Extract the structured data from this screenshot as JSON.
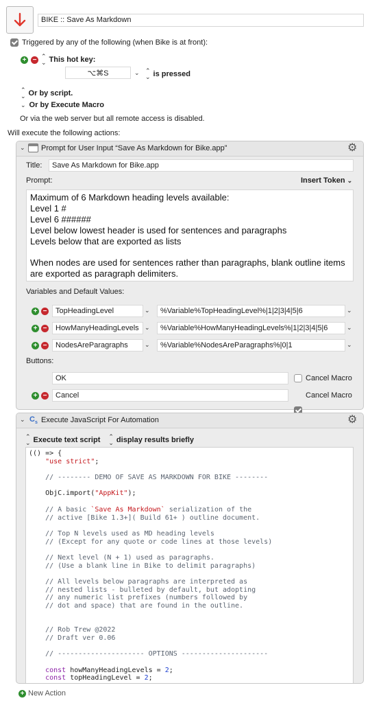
{
  "macro": {
    "name": "BIKE :: Save As Markdown",
    "trigger_text": "Triggered by any of the following (when Bike is at front):",
    "hotkey_label": "This hot key:",
    "hotkey_value": "⌥⌘S",
    "hotkey_condition": "is pressed",
    "by_script_label": "Or by script.",
    "by_execute_macro_label": "Or by Execute Macro",
    "web_server_text": "Or via the web server but all remote access is disabled.",
    "will_execute_text": "Will execute the following actions:",
    "new_action_label": "New Action"
  },
  "prompt_action": {
    "header": "Prompt for User Input “Save As Markdown for Bike.app”",
    "title_label": "Title:",
    "title_value": "Save As Markdown for Bike.app",
    "prompt_label": "Prompt:",
    "insert_token_label": "Insert Token",
    "prompt_lines": [
      "Maximum of 6 Markdown heading levels available:",
      "Level 1 #",
      "Level 6 ######",
      "Level below lowest header is used for sentences and paragraphs",
      "Levels below that are exported as lists",
      "",
      "When nodes are used for sentences rather than paragraphs, blank outline items",
      "are exported as paragraph delimiters."
    ],
    "vars_label": "Variables and Default Values:",
    "variables": [
      {
        "name": "TopHeadingLevel",
        "default": "%Variable%TopHeadingLevel%|1|2|3|4|5|6"
      },
      {
        "name": "HowManyHeadingLevels",
        "default": "%Variable%HowManyHeadingLevels%|1|2|3|4|5|6"
      },
      {
        "name": "NodesAreParagraphs",
        "default": "%Variable%NodesAreParagraphs%|0|1"
      }
    ],
    "buttons_label": "Buttons:",
    "buttons": [
      {
        "label": "OK",
        "cancel_macro_label": "Cancel Macro",
        "cancel_checked": false
      },
      {
        "label": "Cancel",
        "cancel_macro_label": "Cancel Macro",
        "cancel_checked": true
      }
    ]
  },
  "js_action": {
    "header": "Execute JavaScript For Automation",
    "execute_mode": "Execute text script",
    "result_mode": "display results briefly",
    "code_lines": [
      [
        [
          "",
          "(() => {"
        ]
      ],
      [
        [
          "",
          "    "
        ],
        [
          "s",
          "\"use strict\""
        ],
        [
          "",
          ";"
        ]
      ],
      [
        [
          "",
          ""
        ]
      ],
      [
        [
          "",
          "    "
        ],
        [
          "c",
          "// -------- DEMO OF SAVE AS MARKDOWN FOR BIKE --------"
        ]
      ],
      [
        [
          "",
          ""
        ]
      ],
      [
        [
          "",
          "    ObjC.import("
        ],
        [
          "s",
          "\"AppKit\""
        ],
        [
          "",
          ");"
        ]
      ],
      [
        [
          "",
          ""
        ]
      ],
      [
        [
          "",
          "    "
        ],
        [
          "c",
          "// A basic "
        ],
        [
          "s",
          "`Save As Markdown`"
        ],
        [
          "c",
          " serialization of the"
        ]
      ],
      [
        [
          "",
          "    "
        ],
        [
          "c",
          "// active [Bike 1.3+]( Build 61+ ) outline document."
        ]
      ],
      [
        [
          "",
          ""
        ]
      ],
      [
        [
          "",
          "    "
        ],
        [
          "c",
          "// Top N levels used as MD heading levels"
        ]
      ],
      [
        [
          "",
          "    "
        ],
        [
          "c",
          "// (Except for any quote or code lines at those levels)"
        ]
      ],
      [
        [
          "",
          ""
        ]
      ],
      [
        [
          "",
          "    "
        ],
        [
          "c",
          "// Next level (N + 1) used as paragraphs."
        ]
      ],
      [
        [
          "",
          "    "
        ],
        [
          "c",
          "// (Use a blank line in Bike to delimit paragraphs)"
        ]
      ],
      [
        [
          "",
          ""
        ]
      ],
      [
        [
          "",
          "    "
        ],
        [
          "c",
          "// All levels below paragraphs are interpreted as"
        ]
      ],
      [
        [
          "",
          "    "
        ],
        [
          "c",
          "// nested lists - bulleted by default, but adopting"
        ]
      ],
      [
        [
          "",
          "    "
        ],
        [
          "c",
          "// any numeric list prefixes (numbers followed by"
        ]
      ],
      [
        [
          "",
          "    "
        ],
        [
          "c",
          "// dot and space) that are found in the outline."
        ]
      ],
      [
        [
          "",
          ""
        ]
      ],
      [
        [
          "",
          ""
        ]
      ],
      [
        [
          "",
          "    "
        ],
        [
          "c",
          "// Rob Trew @2022"
        ]
      ],
      [
        [
          "",
          "    "
        ],
        [
          "c",
          "// Draft ver 0.06"
        ]
      ],
      [
        [
          "",
          ""
        ]
      ],
      [
        [
          "",
          "    "
        ],
        [
          "c",
          "// --------------------- OPTIONS ---------------------"
        ]
      ],
      [
        [
          "",
          ""
        ]
      ],
      [
        [
          "",
          "    "
        ],
        [
          "k",
          "const"
        ],
        [
          "",
          " howManyHeadingLevels = "
        ],
        [
          "n",
          "2"
        ],
        [
          "",
          ";"
        ]
      ],
      [
        [
          "",
          "    "
        ],
        [
          "k",
          "const"
        ],
        [
          "",
          " topHeadingLevel = "
        ],
        [
          "n",
          "2"
        ],
        [
          "",
          ";"
        ]
      ]
    ]
  },
  "colors": {
    "plus": "#2f8e2f",
    "minus": "#c6282e",
    "arrow_icon": "#e0362c",
    "panel_bg": "#ececec"
  }
}
